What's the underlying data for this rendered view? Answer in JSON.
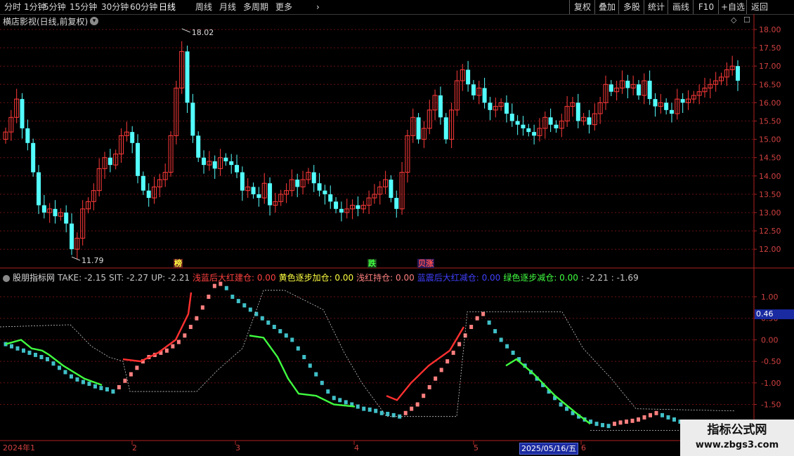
{
  "toolbar": {
    "periods": [
      "分时",
      "1分钟",
      "5分钟",
      "15分钟",
      "30分钟",
      "60分钟",
      "日线",
      "周线",
      "月线",
      "多周期",
      "更多"
    ],
    "active_period": "日线",
    "right_buttons": [
      "复权",
      "叠加",
      "多股",
      "统计",
      "画线",
      "F10",
      "+自选",
      "返回"
    ],
    "more_chevron": "chevron-right-icon"
  },
  "main_chart": {
    "title": "横店影视(日线,前复权)",
    "high_label": "18.02",
    "low_label": "11.79",
    "price_axis": [
      "18.00",
      "17.50",
      "17.00",
      "16.50",
      "16.00",
      "15.50",
      "15.00",
      "14.50",
      "14.00",
      "13.50",
      "13.00",
      "12.50",
      "12.00"
    ],
    "up_color": "#ff3a3a",
    "down_color": "#54ffff"
  },
  "signals": [
    {
      "text": "榜",
      "color": "#ffff40",
      "bg": "#6a2020"
    },
    {
      "text": "跌",
      "color": "#40ff40",
      "bg": "#1a3a1a"
    },
    {
      "text": "贝涨",
      "color": "#ff5050",
      "bg": "#2a1a5a"
    }
  ],
  "indicator": {
    "name": "股朋指标网",
    "items": [
      {
        "label": "TAKE: -2.15",
        "color": "#c8c8c8"
      },
      {
        "label": "SIT: -2.27",
        "color": "#c8c8c8"
      },
      {
        "label": "UP: -2.21",
        "color": "#c8c8c8"
      },
      {
        "label": "浅蓝后大红建仓: 0.00",
        "color": "#ff4040"
      },
      {
        "label": "黄色逐步加仓: 0.00",
        "color": "#ffff40"
      },
      {
        "label": "浅红持仓: 0.00",
        "color": "#ff8080"
      },
      {
        "label": "蓝震后大红减仓: 0.00",
        "color": "#4040ff"
      },
      {
        "label": "绿色逐步减仓: 0.00",
        "color": "#40ff40"
      },
      {
        "label": ": -2.21",
        "color": "#c8c8c8"
      },
      {
        "label": ": -1.69",
        "color": "#c8c8c8"
      }
    ],
    "axis": [
      "1.00",
      "0.50",
      "0.00",
      "-0.50",
      "-1.00",
      "-1.50"
    ],
    "current_value": "0.46"
  },
  "date_axis": {
    "labels": [
      "2024年1",
      "2",
      "3",
      "4",
      "5",
      "6"
    ],
    "cursor_date": "2025/05/16/五"
  },
  "watermark": {
    "line1": "指标公式网",
    "line2": "www.zbgs3.com"
  }
}
